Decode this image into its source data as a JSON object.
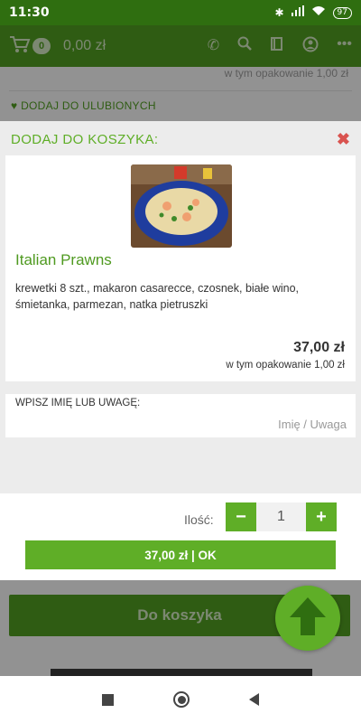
{
  "status": {
    "time": "11:30",
    "battery": "97"
  },
  "header": {
    "cart_count": "0",
    "cart_total": "0,00 zł"
  },
  "behind": {
    "packaging_note": "w tym opakowanie 1,00 zł",
    "favorite_label": "DODAJ DO ULUBIONYCH",
    "add_to_cart_label": "Do koszyka"
  },
  "modal": {
    "title": "DODAJ DO KOSZYKA:",
    "close_symbol": "✖",
    "product": {
      "name": "Italian Prawns",
      "description": "krewetki 8 szt., makaron casarecce, czosnek, białe wino, śmietanka, parmezan, natka pietruszki",
      "price": "37,00 zł",
      "packaging": "w tym opakowanie 1,00 zł"
    },
    "note": {
      "label": "WPISZ IMIĘ LUB UWAGĘ:",
      "placeholder": "Imię / Uwaga",
      "value": ""
    },
    "quantity": {
      "label": "Ilość:",
      "value": "1",
      "minus": "−",
      "plus": "+"
    },
    "ok_button": "37,00 zł | OK"
  },
  "colors": {
    "primary": "#5fae27",
    "header": "#4f9a20",
    "statusbar": "#2f6e10",
    "close": "#d9534f"
  },
  "icons": {
    "header": [
      "cart-icon",
      "phone-icon",
      "search-icon",
      "book-icon",
      "account-icon",
      "more-icon"
    ],
    "fab": "arrow-up-icon",
    "favorite": "heart-icon"
  }
}
